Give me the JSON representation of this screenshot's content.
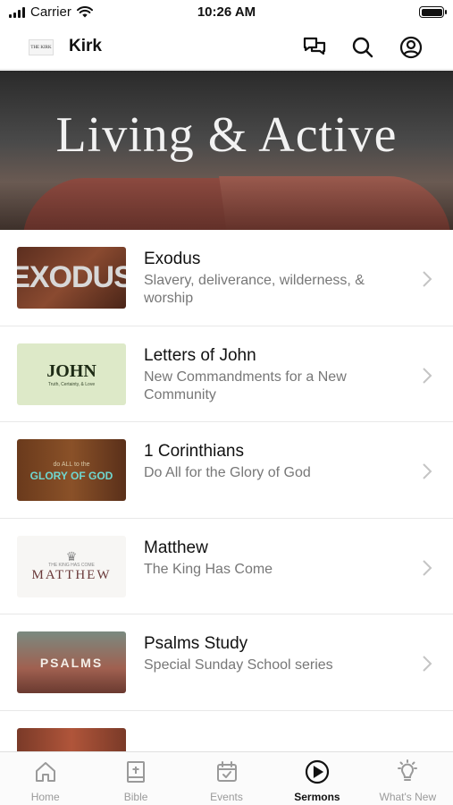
{
  "status_bar": {
    "carrier": "Carrier",
    "time": "10:26 AM"
  },
  "header": {
    "app_title": "Kirk",
    "logo_text": "THE KIRK",
    "icons": [
      "chat-icon",
      "search-icon",
      "account-icon"
    ]
  },
  "hero": {
    "title": "Living & Active"
  },
  "series": [
    {
      "title": "Exodus",
      "subtitle": "Slavery, deliverance, wilderness, & worship",
      "thumb_text": "EXODUS"
    },
    {
      "title": "Letters of John",
      "subtitle": "New Commandments for a New Community",
      "thumb_text": "JOHN",
      "thumb_sub": "Truth, Certainty, & Love"
    },
    {
      "title": "1 Corinthians",
      "subtitle": "Do All for the Glory of God",
      "thumb_text": "GLORY OF GOD",
      "thumb_small": "do ALL to the"
    },
    {
      "title": "Matthew",
      "subtitle": "The King Has Come",
      "thumb_text": "MATTHEW",
      "thumb_small": "THE KING HAS COME"
    },
    {
      "title": "Psalms Study",
      "subtitle": "Special Sunday School series",
      "thumb_text": "PSALMS"
    },
    {
      "title": "",
      "subtitle": "",
      "thumb_text": ""
    }
  ],
  "tabs": [
    {
      "label": "Home",
      "icon": "home-icon",
      "active": false
    },
    {
      "label": "Bible",
      "icon": "bible-icon",
      "active": false
    },
    {
      "label": "Events",
      "icon": "calendar-icon",
      "active": false
    },
    {
      "label": "Sermons",
      "icon": "play-icon",
      "active": true
    },
    {
      "label": "What's New",
      "icon": "lightbulb-icon",
      "active": false
    }
  ],
  "colors": {
    "accent": "#111111",
    "inactive_tab": "#9a9a9a",
    "subtitle": "#777777"
  }
}
